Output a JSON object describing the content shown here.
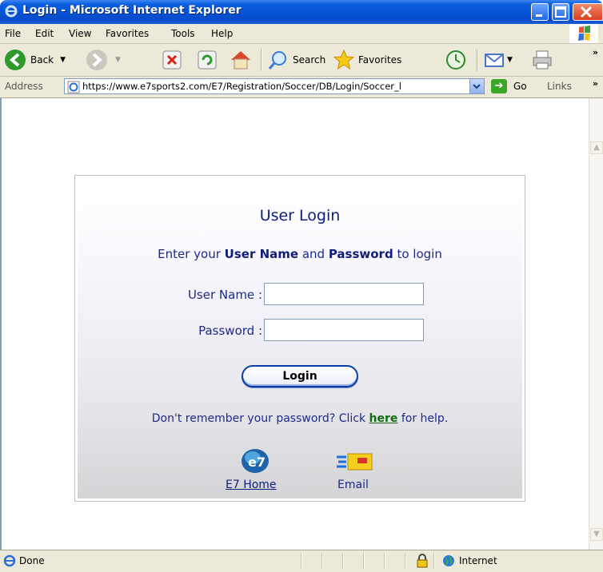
{
  "window": {
    "title": "Login - Microsoft Internet Explorer"
  },
  "menu": [
    "File",
    "Edit",
    "View",
    "Favorites",
    "Tools",
    "Help"
  ],
  "toolbar": {
    "back_label": "Back",
    "search_label": "Search",
    "favorites_label": "Favorites"
  },
  "address": {
    "label": "Address",
    "url": "https://www.e7sports2.com/E7/Registration/Soccer/DB/Login/Soccer_l",
    "go_label": "Go",
    "links_label": "Links"
  },
  "login": {
    "title": "User Login",
    "subtitle_prefix": "Enter your ",
    "subtitle_user": "User Name",
    "subtitle_and": " and ",
    "subtitle_pass": "Password",
    "subtitle_suffix": " to login",
    "username_label": "User Name :",
    "password_label": "Password :",
    "username_value": "",
    "password_value": "",
    "login_button": "Login",
    "forgot_prefix": "Don't remember your password? Click ",
    "forgot_link": "here",
    "forgot_suffix": " for help.",
    "home_label": "E7 Home",
    "email_label": "Email"
  },
  "status": {
    "text": "Done",
    "zone": "Internet"
  },
  "colors": {
    "title_blue": "#0e1e7a",
    "link_green": "#0f6b12",
    "xp_titlebar": "#0551d6"
  }
}
